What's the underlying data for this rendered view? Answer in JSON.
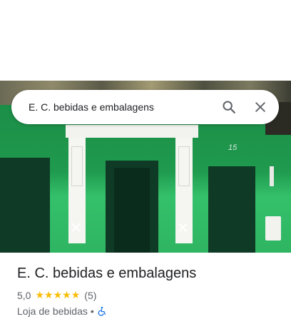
{
  "search": {
    "query": "E. C. bebidas e embalagens"
  },
  "hero": {
    "photo_number": "15"
  },
  "place": {
    "name": "E. C. bebidas e embalagens",
    "rating": "5,0",
    "stars": 5,
    "review_count": "(5)",
    "category": "Loja de bebidas",
    "separator": "•",
    "accessibility_icon": "wheelchair-icon"
  },
  "colors": {
    "star": "#fbbc04",
    "accessibility": "#1a73e8",
    "facade_green": "#1f9a4e"
  }
}
